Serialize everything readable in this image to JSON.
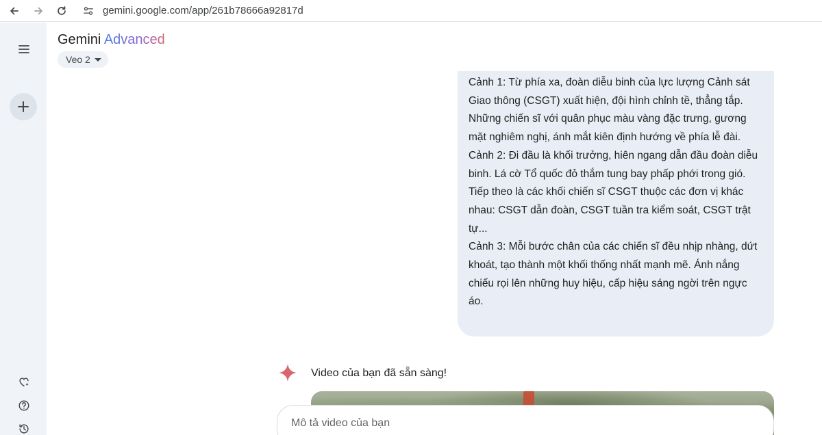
{
  "browser": {
    "url": "gemini.google.com/app/261b78666a92817d",
    "icons": [
      "back-arrow-icon",
      "forward-arrow-icon",
      "reload-icon",
      "site-settings-icon"
    ]
  },
  "rail": {
    "icons": [
      "menu-icon",
      "plus-icon",
      "gem-icon",
      "help-icon",
      "history-icon"
    ]
  },
  "header": {
    "brand": "Gemini",
    "brand_tier": "Advanced",
    "model": "Veo 2"
  },
  "chat": {
    "user_message": [
      "Cảnh 1: Từ phía xa, đoàn diễu binh của lực lượng Cảnh sát Giao thông (CSGT) xuất hiện, đội hình chỉnh tề, thẳng tắp. Những chiến sĩ với quân phục màu vàng đặc trưng, gương mặt nghiêm nghị, ánh mắt kiên định hướng về phía lễ đài.",
      "Cảnh 2: Đi đầu là khối trưởng, hiên ngang dẫn đầu đoàn diễu binh. Lá cờ Tổ quốc đỏ thắm tung bay phấp phới trong gió. Tiếp theo là các khối chiến sĩ CSGT thuộc các đơn vị khác nhau: CSGT dẫn đoàn, CSGT tuần tra kiểm soát, CSGT trật tự...",
      "Cảnh 3: Mỗi bước chân của các chiến sĩ đều nhịp nhàng, dứt khoát, tạo thành một khối thống nhất mạnh mẽ. Ánh nắng chiếu rọi lên những huy hiệu, cấp hiệu sáng ngời trên ngực áo."
    ],
    "response_text": "Video của bạn đã sẵn sàng!"
  },
  "input": {
    "placeholder": "Mô tả video của bạn",
    "value": ""
  },
  "colors": {
    "rail_bg": "#f0f4f9",
    "bubble_bg": "#e9eef6",
    "accent_blue": "#4b7be6",
    "spark_pink": "#d96570"
  }
}
